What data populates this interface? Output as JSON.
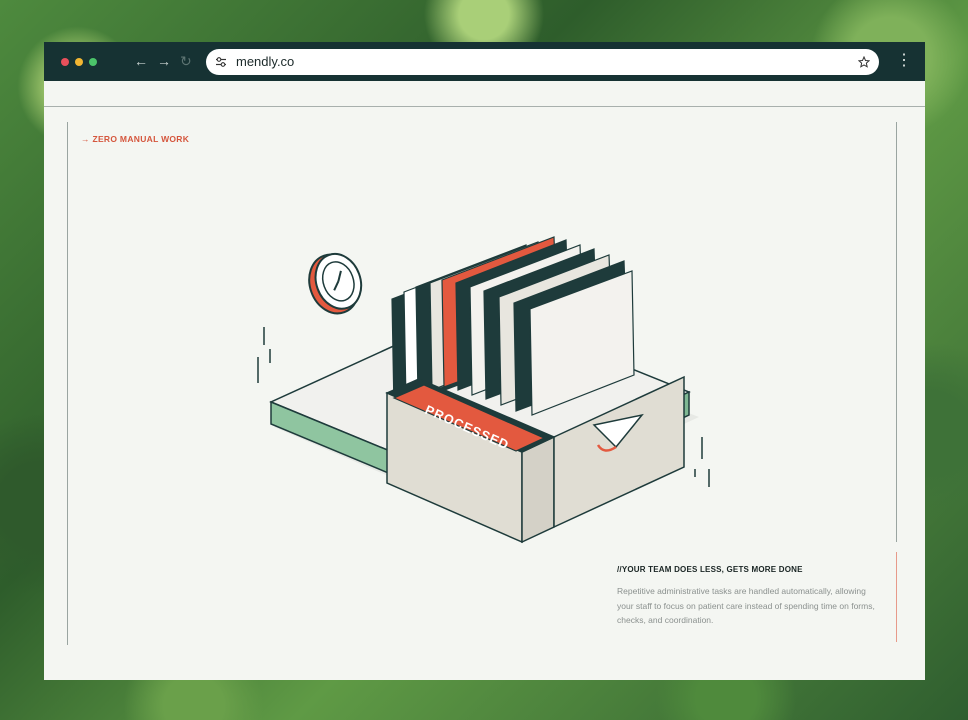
{
  "browser": {
    "url": "mendly.co",
    "colors": {
      "chrome": "#163233",
      "close": "#e8505b",
      "minimize": "#f2b632",
      "maximize": "#4bc46a"
    },
    "icons": [
      "back-arrow-icon",
      "forward-arrow-icon",
      "reload-icon",
      "site-settings-icon",
      "bookmark-star-icon",
      "more-menu-icon"
    ]
  },
  "section": {
    "eyebrow": "→ ZERO MANUAL WORK",
    "heading": "//YOUR TEAM DOES LESS, GETS MORE DONE",
    "body": "Repetitive administrative tasks are handled automatically, allowing your staff to focus on patient care instead of spending time on forms, checks, and coordination."
  },
  "illustration": {
    "label": "PROCESSED",
    "colors": {
      "accent": "#e3593f",
      "dark": "#1e3b3b",
      "base": "#8fc5a0",
      "box": "#e0ddd3"
    }
  }
}
